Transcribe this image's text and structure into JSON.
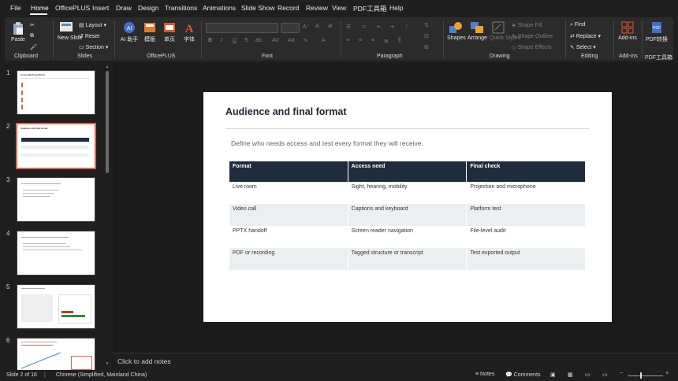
{
  "menu": {
    "items": [
      "File",
      "Home",
      "OfficePLUS",
      "Insert",
      "Draw",
      "Design",
      "Transitions",
      "Animations",
      "Slide Show",
      "Record",
      "Review",
      "View",
      "PDF工具箱",
      "Help"
    ],
    "active": "Home"
  },
  "ribbon": {
    "clipboard": {
      "paste": "Paste",
      "label": "Clipboard"
    },
    "slides": {
      "new_slide": "New Slide",
      "layout": "Layout",
      "reset": "Reset",
      "section": "Section",
      "label": "Slides"
    },
    "officeplus": {
      "ai": "AI 助手",
      "template": "模版",
      "single": "单页",
      "font": "字体",
      "label": "OfficePLUS"
    },
    "font": {
      "label": "Font",
      "bold": "B",
      "italic": "I",
      "underline": "U",
      "strike": "S",
      "shadow": "ab"
    },
    "paragraph": {
      "label": "Paragraph"
    },
    "drawing": {
      "shapes": "Shapes",
      "arrange": "Arrange",
      "quick_styles": "Quick Styles",
      "shape_fill": "Shape Fill",
      "shape_outline": "Shape Outline",
      "shape_effects": "Shape Effects",
      "label": "Drawing"
    },
    "editing": {
      "find": "Find",
      "replace": "Replace",
      "select": "Select",
      "label": "Editing"
    },
    "addins": {
      "addins": "Add-ins",
      "label": "Add-ins"
    },
    "pdf": {
      "convert": "PDF转换",
      "label": "PDF工具箱"
    }
  },
  "thumbnails": [
    {
      "num": "1",
      "title": "Accessible PowerPoint"
    },
    {
      "num": "2",
      "title": "Audience and final format"
    },
    {
      "num": "3",
      "title": ""
    },
    {
      "num": "4",
      "title": ""
    },
    {
      "num": "5",
      "title": ""
    },
    {
      "num": "6",
      "title": ""
    }
  ],
  "slide": {
    "title": "Audience and final format",
    "subtitle": "Define who needs access and test every format they will receive.",
    "table": {
      "headers": [
        "Format",
        "Access need",
        "Final check"
      ],
      "rows": [
        [
          "Live room",
          "Sight, hearing, mobility",
          "Projection and microphone"
        ],
        [
          "Video call",
          "Captions and keyboard",
          "Platform test"
        ],
        [
          "PPTX handoff",
          "Screen reader navigation",
          "File-level audit"
        ],
        [
          "PDF or recording",
          "Tagged structure or transcript",
          "Test exported output"
        ]
      ]
    }
  },
  "notes": {
    "placeholder": "Click to add notes"
  },
  "status": {
    "slide_of": "Slide 2 of 16",
    "language": "Chinese (Simplified, Mainland China)",
    "notes": "Notes",
    "comments": "Comments"
  },
  "colors": {
    "accent": "#e0644c",
    "table_header": "#1e2c3d",
    "table_alt": "#eceff2"
  }
}
